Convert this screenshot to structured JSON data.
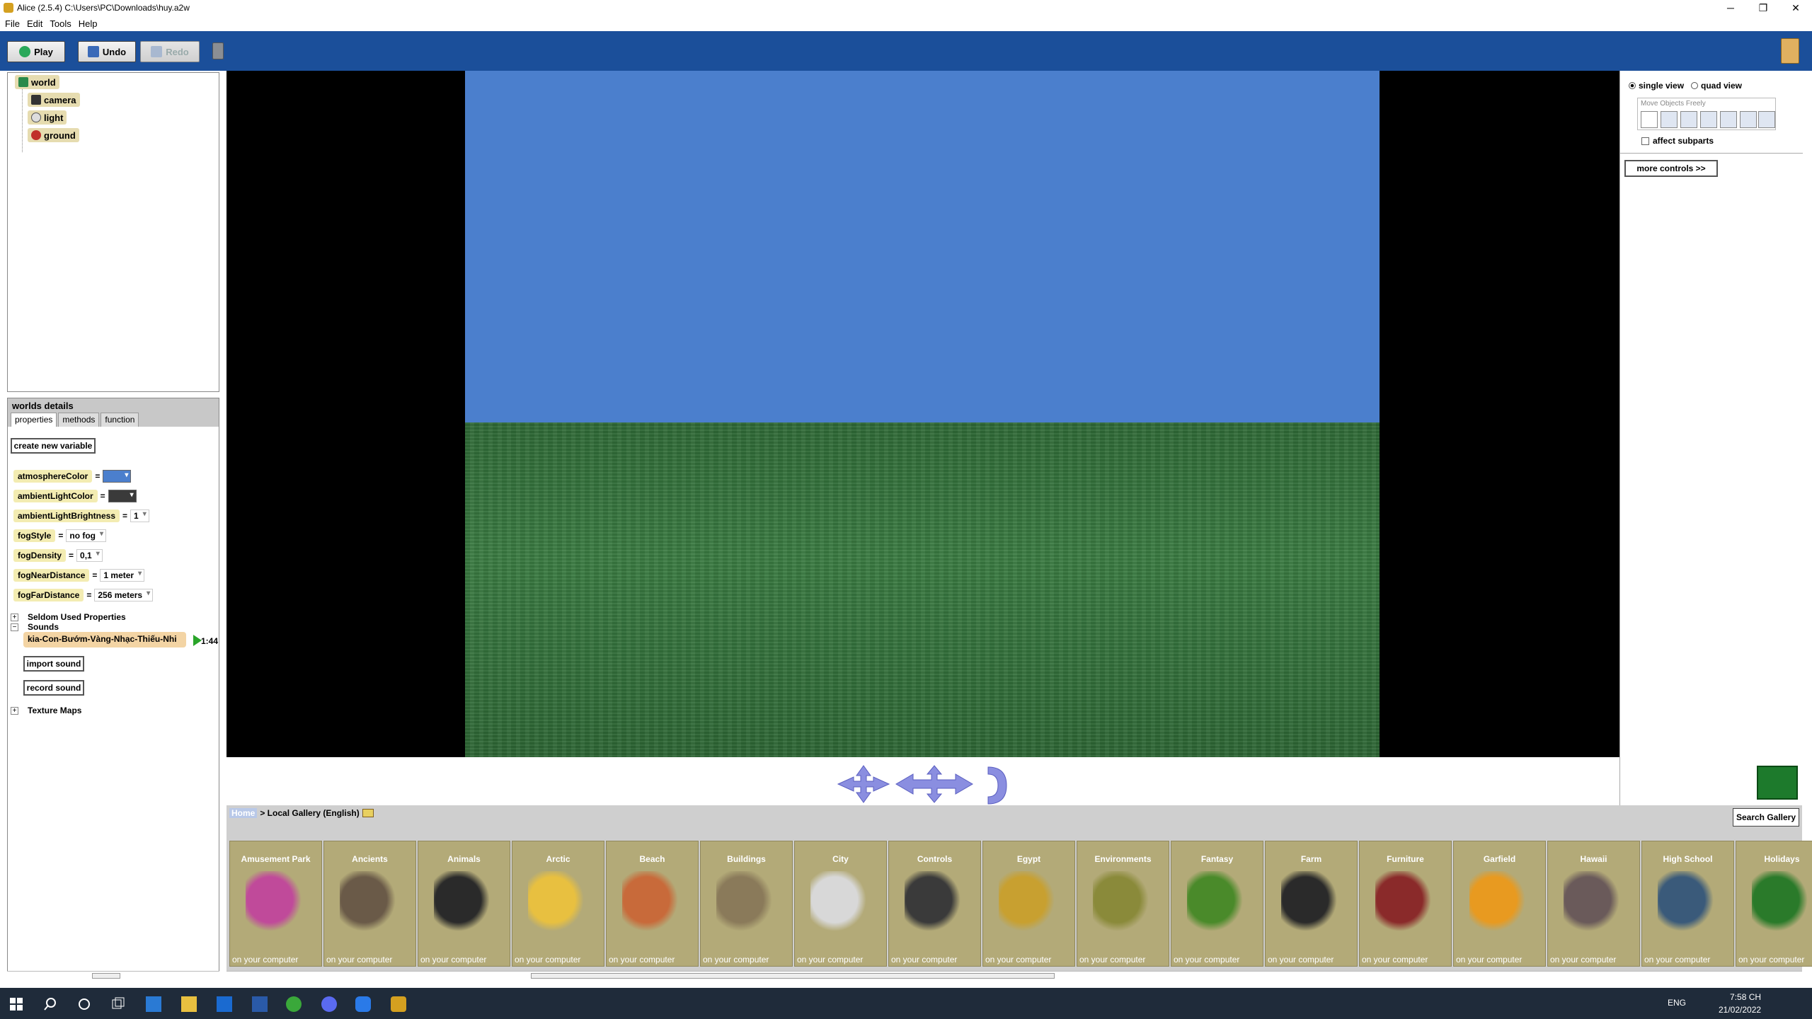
{
  "window": {
    "title": "Alice (2.5.4) C:\\Users\\PC\\Downloads\\huy.a2w",
    "minimize": "─",
    "maximize": "❐",
    "close": "✕"
  },
  "menu": [
    "File",
    "Edit",
    "Tools",
    "Help"
  ],
  "toolbar": {
    "play": "Play",
    "undo": "Undo",
    "redo": "Redo"
  },
  "object_tree": {
    "root": "world",
    "children": [
      "camera",
      "light",
      "ground"
    ]
  },
  "details": {
    "header": "worlds details",
    "tabs": [
      "properties",
      "methods",
      "function"
    ],
    "create_variable": "create new variable",
    "properties": [
      {
        "name": "atmosphereColor",
        "eq": "=",
        "color": "#4b7fcd"
      },
      {
        "name": "ambientLightColor",
        "eq": "=",
        "color": "#3a3a3a"
      },
      {
        "name": "ambientLightBrightness",
        "eq": "=",
        "value": "1"
      },
      {
        "name": "fogStyle",
        "eq": "=",
        "value": "no fog"
      },
      {
        "name": "fogDensity",
        "eq": "=",
        "value": "0,1"
      },
      {
        "name": "fogNearDistance",
        "eq": "=",
        "value": "1 meter"
      },
      {
        "name": "fogFarDistance",
        "eq": "=",
        "value": "256 meters"
      }
    ],
    "seldom_used": "Seldom Used Properties",
    "sounds": "Sounds",
    "sound_item": "kia-Con-Bướm-Vàng-Nhạc-Thiếu-Nhi",
    "sound_length": "1:44",
    "import_sound": "import sound",
    "record_sound": "record sound",
    "texture_maps": "Texture Maps",
    "expand_plus": "+",
    "expand_minus": "−"
  },
  "right_panel": {
    "single_view": "single view",
    "quad_view": "quad view",
    "move_objects": "Move Objects Freely",
    "affect_subparts": "affect subparts",
    "more_controls": "more controls >>"
  },
  "gallery": {
    "home": "Home",
    "breadcrumb": "> Local Gallery (English)",
    "search": "Search Gallery",
    "tile_subtitle": "on your computer",
    "tiles": [
      {
        "name": "Amusement Park",
        "color": "#c04a9a"
      },
      {
        "name": "Ancients",
        "color": "#6a5a48"
      },
      {
        "name": "Animals",
        "color": "#2a2a2a"
      },
      {
        "name": "Arctic",
        "color": "#e8c040"
      },
      {
        "name": "Beach",
        "color": "#c86a3a"
      },
      {
        "name": "Buildings",
        "color": "#8a7a5a"
      },
      {
        "name": "City",
        "color": "#d8d8d8"
      },
      {
        "name": "Controls",
        "color": "#3a3a3a"
      },
      {
        "name": "Egypt",
        "color": "#c8a030"
      },
      {
        "name": "Environments",
        "color": "#8a8a3a"
      },
      {
        "name": "Fantasy",
        "color": "#4a8a2a"
      },
      {
        "name": "Farm",
        "color": "#2a2a2a"
      },
      {
        "name": "Furniture",
        "color": "#8a2a2a"
      },
      {
        "name": "Garfield",
        "color": "#e89a20"
      },
      {
        "name": "Hawaii",
        "color": "#6a5a5a"
      },
      {
        "name": "High School",
        "color": "#3a5a7a"
      },
      {
        "name": "Holidays",
        "color": "#2a7a2a"
      }
    ]
  },
  "taskbar": {
    "language": "ENG",
    "time": "7:58 CH",
    "date": "21/02/2022"
  }
}
